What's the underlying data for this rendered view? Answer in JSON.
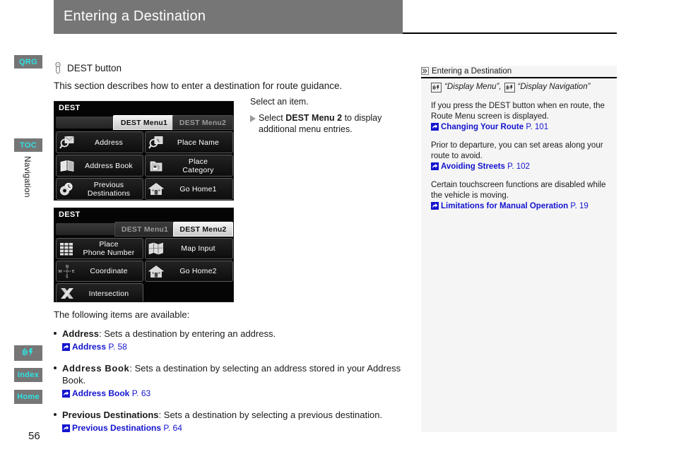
{
  "header": {
    "title": "Entering a Destination"
  },
  "sidebar": {
    "tabs": [
      {
        "label": "QRG",
        "name": "qrg"
      },
      {
        "label": "TOC",
        "name": "toc"
      },
      {
        "label": "",
        "name": "voice-command",
        "icon": "voice-icon"
      },
      {
        "label": "Index",
        "name": "index"
      },
      {
        "label": "Home",
        "name": "home"
      }
    ],
    "section_label": "Navigation",
    "page_number": "56"
  },
  "body": {
    "dest_button_line": "DEST button",
    "dest_button_icon": "press-button-icon",
    "intro": "This section describes how to enter a destination for route guidance.",
    "callout": {
      "line1": "Select an item.",
      "sub_prefix": "Select ",
      "sub_bold": "DEST Menu 2",
      "sub_suffix": " to display additional menu entries."
    },
    "lead": "The following items are available:",
    "items": [
      {
        "term": "Address",
        "desc": ": Sets a destination by entering an address.",
        "xref_name": "Address",
        "xref_page": "P. 58",
        "wide": false
      },
      {
        "term": "Address Book",
        "desc": ": Sets a destination by selecting an address stored in your Address Book.",
        "xref_name": "Address Book",
        "xref_page": "P. 63",
        "wide": true
      },
      {
        "term": "Previous Destinations",
        "desc": ": Sets a destination by selecting a previous destination.",
        "xref_name": "Previous Destinations",
        "xref_page": "P. 64",
        "wide": true
      }
    ]
  },
  "navshots": [
    {
      "title": "DEST",
      "tabs": [
        {
          "label": "DEST Menu1",
          "active": true
        },
        {
          "label": "DEST Menu2",
          "active": false
        }
      ],
      "buttons": [
        {
          "label": "Address",
          "icon": "magnifier-envelope-icon",
          "col": 0,
          "row": 0
        },
        {
          "label": "Place Name",
          "icon": "magnifier-letter-icon",
          "col": 1,
          "row": 0
        },
        {
          "label": "Address Book",
          "icon": "open-book-icon",
          "col": 0,
          "row": 1
        },
        {
          "label": "Place\nCategory",
          "icon": "fuel-folder-icon",
          "col": 1,
          "row": 1
        },
        {
          "label": "Previous\nDestinations",
          "icon": "clock-disc-icon",
          "col": 0,
          "row": 2
        },
        {
          "label": "Go Home1",
          "icon": "house-icon",
          "col": 1,
          "row": 2
        }
      ]
    },
    {
      "title": "DEST",
      "tabs": [
        {
          "label": "DEST Menu1",
          "active": false
        },
        {
          "label": "DEST Menu2",
          "active": true
        }
      ],
      "buttons": [
        {
          "label": "Place\nPhone Number",
          "icon": "keypad-icon",
          "col": 0,
          "row": 0
        },
        {
          "label": "Map Input",
          "icon": "folded-map-icon",
          "col": 1,
          "row": 0
        },
        {
          "label": "Coordinate",
          "icon": "compass-icon",
          "col": 0,
          "row": 1
        },
        {
          "label": "Go Home2",
          "icon": "house-icon",
          "col": 1,
          "row": 1
        },
        {
          "label": "Intersection",
          "icon": "crossroads-icon",
          "col": 0,
          "row": 2
        }
      ]
    }
  ],
  "right_panel": {
    "heading": "Entering a Destination",
    "heading_icon": "double-chevron-icon",
    "voice_commands": [
      {
        "icon": "voice-icon",
        "text": "“Display Menu”,"
      },
      {
        "icon": "voice-icon",
        "text": "“Display Navigation”"
      }
    ],
    "paragraphs": [
      {
        "text": "If you press the DEST button when en route, the Route Menu screen is displayed.",
        "xref_name": "Changing Your Route",
        "xref_page": "P. 101"
      },
      {
        "text": "Prior to departure, you can set areas along your route to avoid.",
        "xref_name": "Avoiding Streets",
        "xref_page": "P. 102"
      },
      {
        "text": "Certain touchscreen functions are disabled while the vehicle is moving.",
        "xref_name": "Limitations for Manual Operation",
        "xref_page": "P. 19"
      }
    ]
  },
  "colors": {
    "header_bg": "#767676",
    "tab_text": "#2fe3e3",
    "link": "#1414cf",
    "panel_bg": "#f5f5f5"
  }
}
